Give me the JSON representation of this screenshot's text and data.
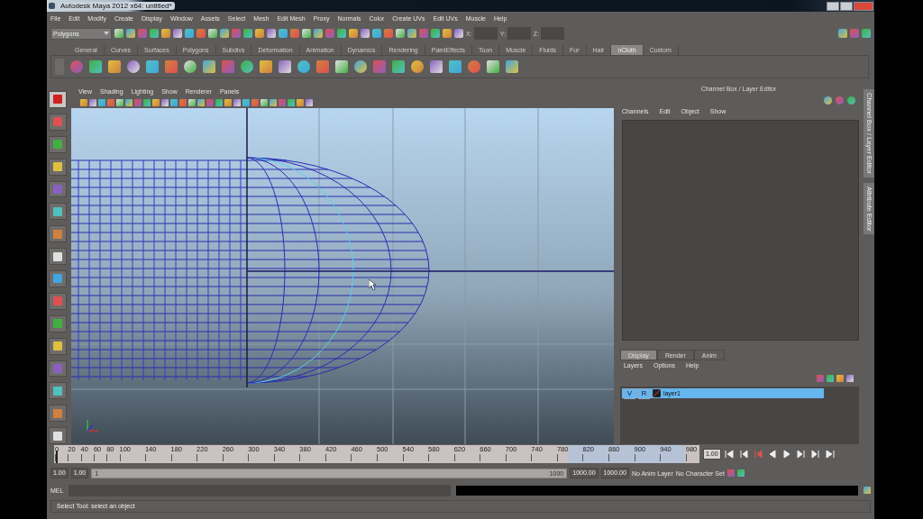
{
  "window": {
    "title": "Autodesk Maya 2012 x64: untitled*"
  },
  "menu_bar": [
    "File",
    "Edit",
    "Modify",
    "Create",
    "Display",
    "Window",
    "Assets",
    "Select",
    "Mesh",
    "Edit Mesh",
    "Proxy",
    "Normals",
    "Color",
    "Create UVs",
    "Edit UVs",
    "Muscle",
    "Help"
  ],
  "status_line": {
    "menu_set": "Polygons",
    "fields": [
      {
        "label": "X:"
      },
      {
        "label": "Y:"
      },
      {
        "label": "Z:"
      }
    ]
  },
  "shelf": {
    "tabs": [
      {
        "label": "General",
        "selected": false
      },
      {
        "label": "Curves",
        "selected": false
      },
      {
        "label": "Surfaces",
        "selected": false
      },
      {
        "label": "Polygons",
        "selected": false
      },
      {
        "label": "Subdivs",
        "selected": false
      },
      {
        "label": "Deformation",
        "selected": false
      },
      {
        "label": "Animation",
        "selected": false
      },
      {
        "label": "Dynamics",
        "selected": false
      },
      {
        "label": "Rendering",
        "selected": false
      },
      {
        "label": "PaintEffects",
        "selected": false
      },
      {
        "label": "Toon",
        "selected": false
      },
      {
        "label": "Muscle",
        "selected": false
      },
      {
        "label": "Fluids",
        "selected": false
      },
      {
        "label": "Fur",
        "selected": false
      },
      {
        "label": "Hair",
        "selected": false
      },
      {
        "label": "nCloth",
        "selected": true
      },
      {
        "label": "Custom",
        "selected": false
      }
    ]
  },
  "toolbox": {
    "tools": [
      {
        "selected": true
      },
      {
        "selected": false
      },
      {
        "selected": false
      },
      {
        "selected": false
      },
      {
        "selected": false
      },
      {
        "selected": false
      },
      {
        "selected": false
      },
      {
        "selected": false
      },
      {
        "selected": false
      },
      {
        "selected": false
      },
      {
        "selected": false
      },
      {
        "selected": false
      },
      {
        "selected": false
      },
      {
        "selected": false
      },
      {
        "selected": false
      },
      {
        "selected": false
      }
    ]
  },
  "viewport": {
    "menus": [
      "View",
      "Shading",
      "Lighting",
      "Show",
      "Renderer",
      "Panels"
    ]
  },
  "channel_box": {
    "title": "Channel Box / Layer Editor",
    "menus": [
      "Channels",
      "Edit",
      "Object",
      "Show"
    ]
  },
  "layer_editor": {
    "tabs": [
      {
        "label": "Display",
        "selected": true
      },
      {
        "label": "Render",
        "selected": false
      },
      {
        "label": "Anim",
        "selected": false
      }
    ],
    "menus": [
      "Layers",
      "Options",
      "Help"
    ],
    "layers": [
      {
        "visible": "V",
        "render": "R",
        "name": "layer1",
        "selected": true
      }
    ]
  },
  "side_tabs": [
    "Channel Box / Layer Editor",
    "Attribute Editor"
  ],
  "time_slider": {
    "ticks": [
      "0",
      "20",
      "40",
      "60",
      "80",
      "100",
      "140",
      "180",
      "220",
      "260",
      "300",
      "340",
      "380",
      "420",
      "460",
      "500",
      "540",
      "580",
      "620",
      "660",
      "700",
      "740",
      "780",
      "820",
      "860",
      "900",
      "940",
      "980"
    ],
    "current_time": "1.00",
    "level": 0.001
  },
  "range_slider": {
    "start_time": "1.00",
    "playback_start": "1.00",
    "range_start": "1",
    "range_end": "1000",
    "playback_end": "1000.00",
    "end_time": "1000.00",
    "anim_layer": "No Anim Layer",
    "character_set": "No Character Set",
    "level": 1
  },
  "command_line": {
    "label": "MEL"
  },
  "help_line": "Select Tool: select an object"
}
